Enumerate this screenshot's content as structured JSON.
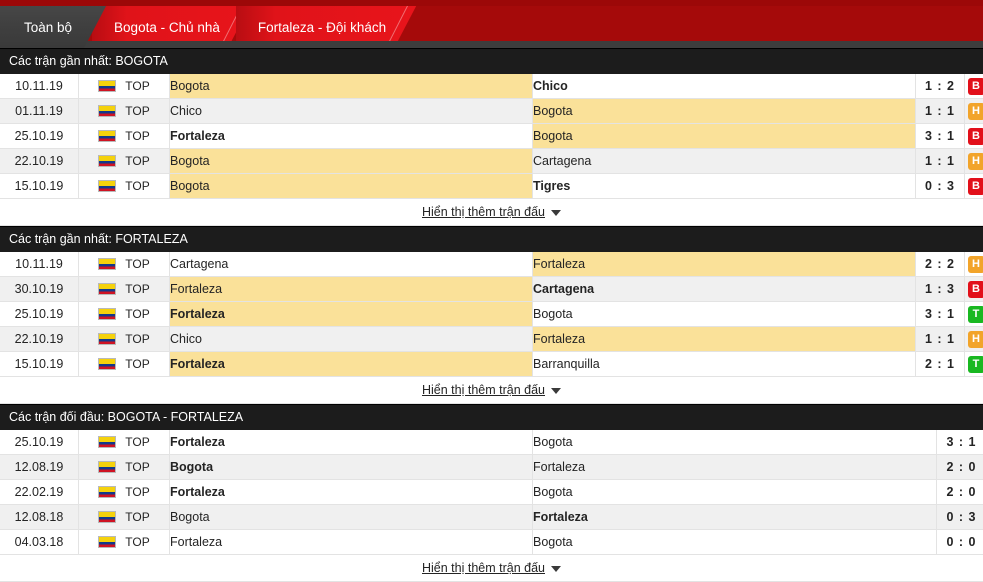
{
  "tabs": [
    {
      "label": "Toàn bộ",
      "active": true
    },
    {
      "label": "Bogota - Chủ nhà",
      "active": false
    },
    {
      "label": "Fortaleza - Đội khách",
      "active": false
    }
  ],
  "colors": {
    "brand_red": "#c20d13",
    "tab_active": "#3d3d3d",
    "section_header": "#1c1c1c",
    "highlight": "#fae199",
    "badge_loss": "#e2101a",
    "badge_draw": "#f2a42a",
    "badge_win": "#19b821"
  },
  "show_more_label": "Hiển thị thêm trận đấu",
  "league_code": "TOP",
  "flag_icon": "colombia-flag",
  "sections": [
    {
      "id": "recent-bogota",
      "title": "Các trận gần nhất: BOGOTA",
      "has_badges": true,
      "rows": [
        {
          "date": "10.11.19",
          "league": "TOP",
          "home": "Bogota",
          "away": "Chico",
          "home_hl": true,
          "away_hl": false,
          "home_win": false,
          "away_win": true,
          "score": "1 : 2",
          "badge": "B",
          "badge_type": "loss"
        },
        {
          "date": "01.11.19",
          "league": "TOP",
          "home": "Chico",
          "away": "Bogota",
          "home_hl": false,
          "away_hl": true,
          "home_win": false,
          "away_win": false,
          "score": "1 : 1",
          "badge": "H",
          "badge_type": "draw"
        },
        {
          "date": "25.10.19",
          "league": "TOP",
          "home": "Fortaleza",
          "away": "Bogota",
          "home_hl": false,
          "away_hl": true,
          "home_win": true,
          "away_win": false,
          "score": "3 : 1",
          "badge": "B",
          "badge_type": "loss"
        },
        {
          "date": "22.10.19",
          "league": "TOP",
          "home": "Bogota",
          "away": "Cartagena",
          "home_hl": true,
          "away_hl": false,
          "home_win": false,
          "away_win": false,
          "score": "1 : 1",
          "badge": "H",
          "badge_type": "draw"
        },
        {
          "date": "15.10.19",
          "league": "TOP",
          "home": "Bogota",
          "away": "Tigres",
          "home_hl": true,
          "away_hl": false,
          "home_win": false,
          "away_win": true,
          "score": "0 : 3",
          "badge": "B",
          "badge_type": "loss"
        }
      ]
    },
    {
      "id": "recent-fortaleza",
      "title": "Các trận gần nhất: FORTALEZA",
      "has_badges": true,
      "rows": [
        {
          "date": "10.11.19",
          "league": "TOP",
          "home": "Cartagena",
          "away": "Fortaleza",
          "home_hl": false,
          "away_hl": true,
          "home_win": false,
          "away_win": false,
          "score": "2 : 2",
          "badge": "H",
          "badge_type": "draw"
        },
        {
          "date": "30.10.19",
          "league": "TOP",
          "home": "Fortaleza",
          "away": "Cartagena",
          "home_hl": true,
          "away_hl": false,
          "home_win": false,
          "away_win": true,
          "score": "1 : 3",
          "badge": "B",
          "badge_type": "loss"
        },
        {
          "date": "25.10.19",
          "league": "TOP",
          "home": "Fortaleza",
          "away": "Bogota",
          "home_hl": true,
          "away_hl": false,
          "home_win": true,
          "away_win": false,
          "score": "3 : 1",
          "badge": "T",
          "badge_type": "win"
        },
        {
          "date": "22.10.19",
          "league": "TOP",
          "home": "Chico",
          "away": "Fortaleza",
          "home_hl": false,
          "away_hl": true,
          "home_win": false,
          "away_win": false,
          "score": "1 : 1",
          "badge": "H",
          "badge_type": "draw"
        },
        {
          "date": "15.10.19",
          "league": "TOP",
          "home": "Fortaleza",
          "away": "Barranquilla",
          "home_hl": true,
          "away_hl": false,
          "home_win": true,
          "away_win": false,
          "score": "2 : 1",
          "badge": "T",
          "badge_type": "win"
        }
      ]
    },
    {
      "id": "head-to-head",
      "title": "Các trận đối đầu: BOGOTA - FORTALEZA",
      "has_badges": false,
      "rows": [
        {
          "date": "25.10.19",
          "league": "TOP",
          "home": "Fortaleza",
          "away": "Bogota",
          "home_hl": false,
          "away_hl": false,
          "home_win": true,
          "away_win": false,
          "score": "3 : 1",
          "badge": "",
          "badge_type": ""
        },
        {
          "date": "12.08.19",
          "league": "TOP",
          "home": "Bogota",
          "away": "Fortaleza",
          "home_hl": false,
          "away_hl": false,
          "home_win": true,
          "away_win": false,
          "score": "2 : 0",
          "badge": "",
          "badge_type": ""
        },
        {
          "date": "22.02.19",
          "league": "TOP",
          "home": "Fortaleza",
          "away": "Bogota",
          "home_hl": false,
          "away_hl": false,
          "home_win": true,
          "away_win": false,
          "score": "2 : 0",
          "badge": "",
          "badge_type": ""
        },
        {
          "date": "12.08.18",
          "league": "TOP",
          "home": "Bogota",
          "away": "Fortaleza",
          "home_hl": false,
          "away_hl": false,
          "home_win": false,
          "away_win": true,
          "score": "0 : 3",
          "badge": "",
          "badge_type": ""
        },
        {
          "date": "04.03.18",
          "league": "TOP",
          "home": "Fortaleza",
          "away": "Bogota",
          "home_hl": false,
          "away_hl": false,
          "home_win": false,
          "away_win": false,
          "score": "0 : 0",
          "badge": "",
          "badge_type": ""
        }
      ]
    }
  ]
}
